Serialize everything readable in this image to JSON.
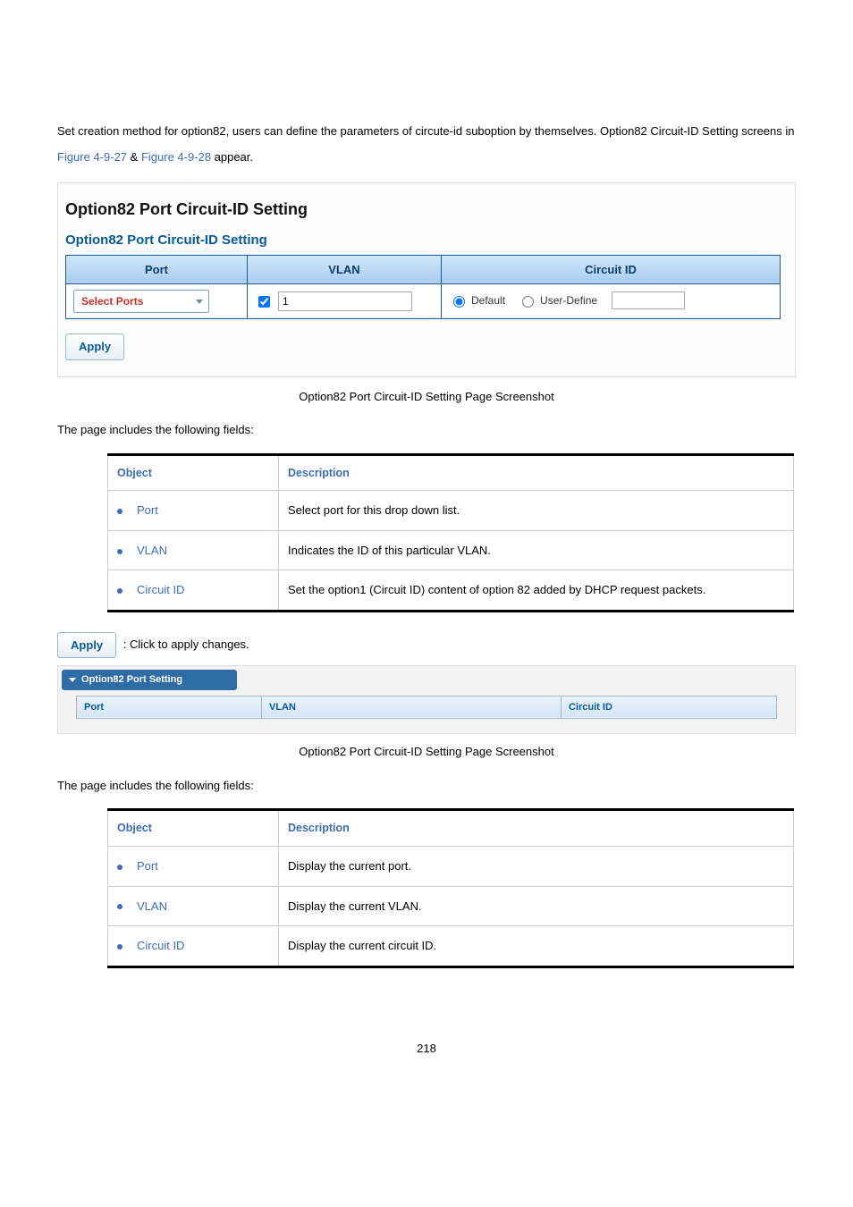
{
  "intro": {
    "text_a": "Set creation method for option82, users can define the parameters of circute-id suboption by themselves. Option82 Circuit-ID Setting screens in ",
    "link1": "Figure 4-9-27",
    "amp": " & ",
    "link2": "Figure 4-9-28",
    "text_b": " appear."
  },
  "screenshot1": {
    "title": "Option82 Port Circuit-ID Setting",
    "subtitle": "Option82 Port Circuit-ID Setting",
    "headers": {
      "port": "Port",
      "vlan": "VLAN",
      "cid": "Circuit ID"
    },
    "port_dd": "Select Ports",
    "vlan_value": "1",
    "radio_default": "Default",
    "radio_user": "User-Define",
    "apply": "Apply"
  },
  "caption1": "Option82 Port Circuit-ID Setting Page Screenshot",
  "lead1": "The page includes the following fields:",
  "obj_table1": {
    "h_obj": "Object",
    "h_desc": "Description",
    "rows": [
      {
        "obj": "Port",
        "desc": "Select port for this drop down list."
      },
      {
        "obj": "VLAN",
        "desc": "Indicates the ID of this particular VLAN."
      },
      {
        "obj": "Circuit ID",
        "desc": "Set the option1 (Circuit ID) content of option 82 added by DHCP request packets."
      }
    ]
  },
  "apply_row": {
    "btn": "Apply",
    "text": ": Click to apply changes."
  },
  "screenshot2": {
    "panel_title": "Option82 Port Setting",
    "headers": {
      "port": "Port",
      "vlan": "VLAN",
      "cid": "Circuit ID"
    }
  },
  "caption2": "Option82 Port Circuit-ID Setting Page Screenshot",
  "lead2": "The page includes the following fields:",
  "obj_table2": {
    "h_obj": "Object",
    "h_desc": "Description",
    "rows": [
      {
        "obj": "Port",
        "desc": "Display the current port."
      },
      {
        "obj": "VLAN",
        "desc": "Display the current VLAN."
      },
      {
        "obj": "Circuit ID",
        "desc": "Display the current circuit ID."
      }
    ]
  },
  "pagenum": "218"
}
